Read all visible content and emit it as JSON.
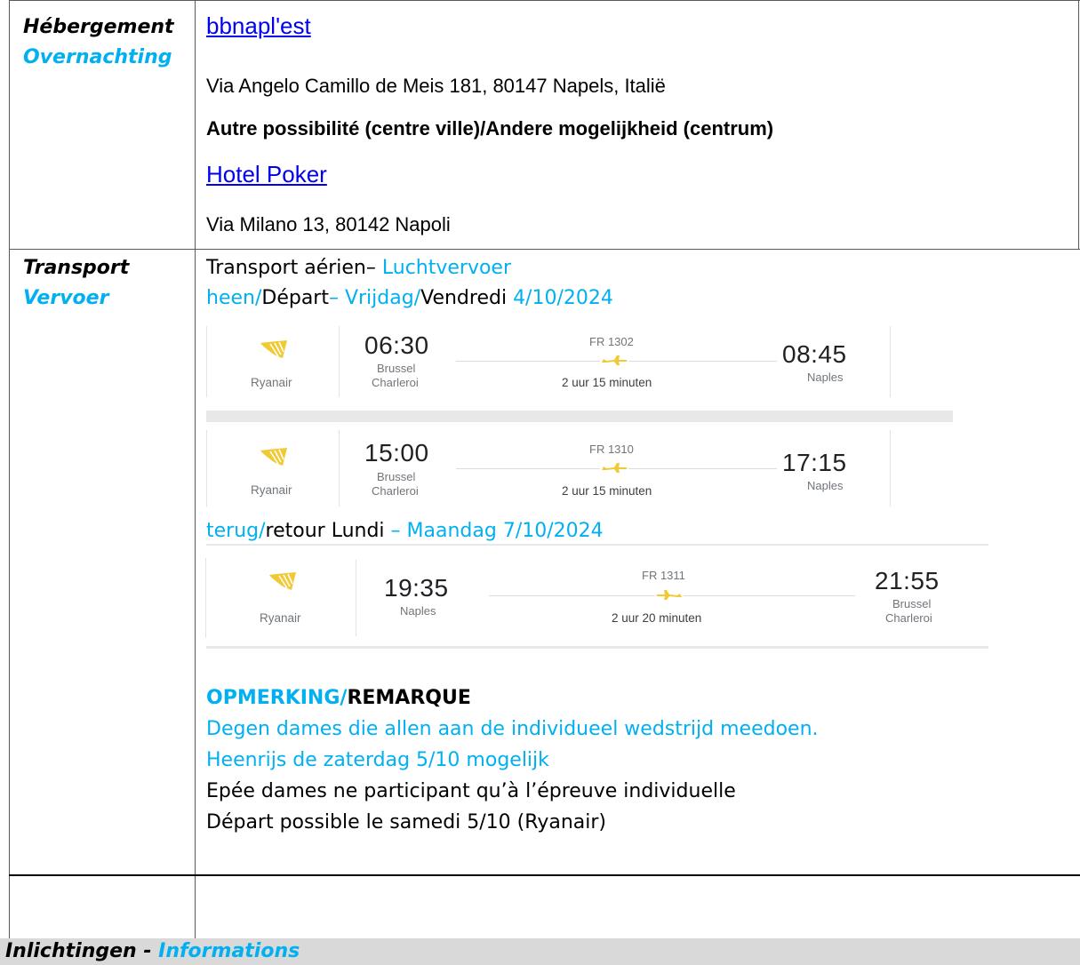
{
  "accommodation": {
    "label_fr": "Hébergement",
    "label_nl": "Overnachting",
    "hotel1_name": "bbnapl'est",
    "hotel1_address": " Via Angelo Camillo de Meis 181, 80147 Napels, Italië",
    "alt_heading": "Autre possibilité (centre ville)/Andere mogelijkheid (centrum)",
    "hotel2_name": "Hotel Poker",
    "hotel2_address": "Via Milano 13, 80142 Napoli"
  },
  "transport": {
    "label_fr": "Transport",
    "label_nl": "Vervoer",
    "air_fr": "Transport aérien– ",
    "air_nl": "Luchtvervoer",
    "outbound": {
      "p1": "heen/",
      "p2": "Départ",
      "p3": "– Vrijdag/",
      "p4": "Vendredi ",
      "p5": "4/10/2024"
    },
    "return": {
      "p1": "terug/",
      "p2": "retour Lundi ",
      "p3": "– Maandag 7/10/2024"
    },
    "flights": [
      {
        "airline": "Ryanair",
        "dep_time": "06:30",
        "dep_city": "Brussel",
        "dep_airport": "Charleroi",
        "flight_no": "FR 1302",
        "duration": "2 uur 15 minuten",
        "arr_time": "08:45",
        "arr_city": "Naples",
        "arr_airport": ""
      },
      {
        "airline": "Ryanair",
        "dep_time": "15:00",
        "dep_city": "Brussel",
        "dep_airport": "Charleroi",
        "flight_no": "FR 1310",
        "duration": "2 uur 15 minuten",
        "arr_time": "17:15",
        "arr_city": "Naples",
        "arr_airport": ""
      },
      {
        "airline": "Ryanair",
        "dep_time": "19:35",
        "dep_city": "Naples",
        "dep_airport": "",
        "flight_no": "FR 1311",
        "duration": "2 uur 20 minuten",
        "arr_time": "21:55",
        "arr_city": "Brussel",
        "arr_airport": "Charleroi"
      }
    ],
    "remark": {
      "head_nl": "OPMERKING/",
      "head_fr": "REMARQUE",
      "nl_line1": "Degen dames die allen aan de individueel wedstrijd meedoen.",
      "nl_line2": "Heenrijs de zaterdag 5/10 mogelijk",
      "fr_line1": "Epée dames ne participant qu’à l’épreuve individuelle",
      "fr_line2": "Départ possible le samedi 5/10 (Ryanair)"
    }
  },
  "footer": {
    "nl": "Inlichtingen - ",
    "fr": "Informations"
  },
  "colors": {
    "cyan": "#00b0f0",
    "ryanair_yellow": "#f1c933",
    "link": "#0000ee"
  },
  "icons": [
    "ryanair-logo-icon",
    "plane-right-icon",
    "plane-left-icon"
  ]
}
